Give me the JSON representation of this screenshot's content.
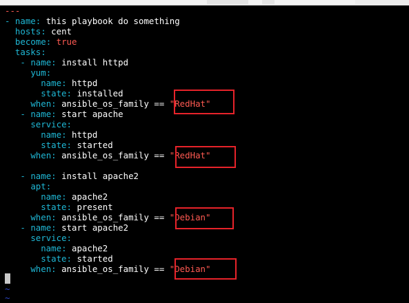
{
  "window": {
    "title_bar": ""
  },
  "editor": {
    "doc_start": "---",
    "lines": [
      {
        "indent": "- ",
        "key": "name",
        "value": "this playbook do something",
        "value_style": "v"
      },
      {
        "indent": "  ",
        "key": "hosts",
        "value": "cent",
        "value_style": "v"
      },
      {
        "indent": "  ",
        "key": "become",
        "value": "true",
        "value_style": "r"
      },
      {
        "indent": "  ",
        "key": "tasks",
        "value": "",
        "value_style": "v"
      },
      {
        "indent": "   - ",
        "key": "name",
        "value": "install httpd",
        "value_style": "v"
      },
      {
        "indent": "     ",
        "key": "yum",
        "value": "",
        "value_style": "v"
      },
      {
        "indent": "       ",
        "key": "name",
        "value": "httpd",
        "value_style": "v"
      },
      {
        "indent": "       ",
        "key": "state",
        "value": "installed",
        "value_style": "v"
      },
      {
        "indent": "     ",
        "key": "when",
        "value": "ansible_os_family ==",
        "value_style": "v",
        "str": "\"RedHat\""
      },
      {
        "indent": "   - ",
        "key": "name",
        "value": "start apache",
        "value_style": "v"
      },
      {
        "indent": "     ",
        "key": "service",
        "value": "",
        "value_style": "v"
      },
      {
        "indent": "       ",
        "key": "name",
        "value": "httpd",
        "value_style": "v"
      },
      {
        "indent": "       ",
        "key": "state",
        "value": "started",
        "value_style": "v"
      },
      {
        "indent": "     ",
        "key": "when",
        "value": "ansible_os_family ==",
        "value_style": "v",
        "str": "\"RedHat\""
      },
      {
        "indent": "",
        "key": "",
        "value": "",
        "value_style": "v"
      },
      {
        "indent": "   - ",
        "key": "name",
        "value": "install apache2",
        "value_style": "v"
      },
      {
        "indent": "     ",
        "key": "apt",
        "value": "",
        "value_style": "v"
      },
      {
        "indent": "       ",
        "key": "name",
        "value": "apache2",
        "value_style": "v"
      },
      {
        "indent": "       ",
        "key": "state",
        "value": "present",
        "value_style": "v"
      },
      {
        "indent": "     ",
        "key": "when",
        "value": "ansible_os_family ==",
        "value_style": "v",
        "str": "\"Debian\""
      },
      {
        "indent": "   - ",
        "key": "name",
        "value": "start apache2",
        "value_style": "v"
      },
      {
        "indent": "     ",
        "key": "service",
        "value": "",
        "value_style": "v"
      },
      {
        "indent": "       ",
        "key": "name",
        "value": "apache2",
        "value_style": "v"
      },
      {
        "indent": "       ",
        "key": "state",
        "value": "started",
        "value_style": "v"
      },
      {
        "indent": "     ",
        "key": "when",
        "value": "ansible_os_family ==",
        "value_style": "v",
        "str": "\"Debian\""
      }
    ],
    "empty_line_marker": "~"
  },
  "colors": {
    "background": "#000000",
    "key": "#1fb8d6",
    "string": "#ff5a52",
    "highlight_box": "#e8232a",
    "tilde": "#2e48c9"
  }
}
